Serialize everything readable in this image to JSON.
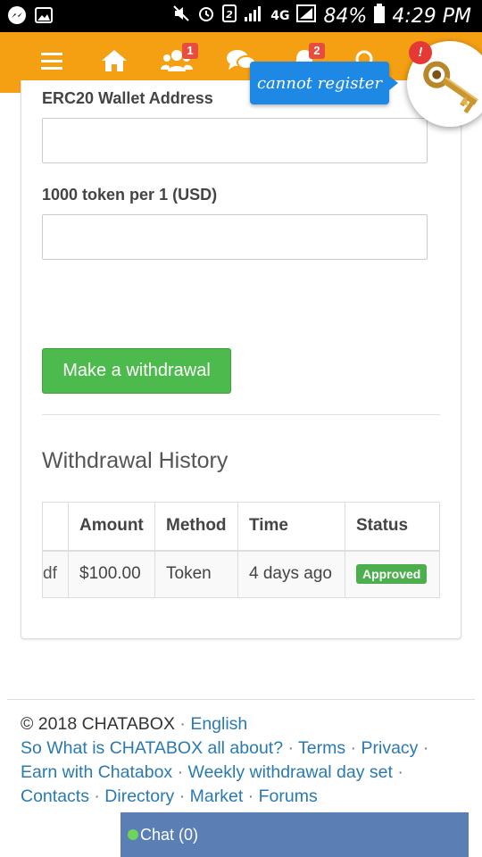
{
  "status_bar": {
    "battery_percent": "84%",
    "time": "4:29 PM",
    "network": "4G"
  },
  "nav": {
    "badges": {
      "users": "1",
      "notifications": "2"
    },
    "alert_dot": "!"
  },
  "tooltip": {
    "text": "cannot register"
  },
  "form": {
    "wallet_label": "ERC20 Wallet Address",
    "wallet_value": "",
    "rate_label": "1000 token per 1 (USD)",
    "rate_value": "",
    "submit_label": "Make a withdrawal"
  },
  "history": {
    "title": "Withdrawal History",
    "columns": [
      "",
      "Amount",
      "Method",
      "Time",
      "Status"
    ],
    "rows": [
      {
        "id": "df",
        "amount": "$100.00",
        "method": "Token",
        "time": "4 days ago",
        "status": "Approved"
      }
    ]
  },
  "footer": {
    "copyright": "© 2018 CHATABOX",
    "language": "English",
    "links": [
      "So What is CHATABOX all about?",
      "Terms",
      "Privacy",
      "Earn with Chatabox",
      "Weekly withdrawal day set",
      "Contacts",
      "Directory",
      "Market",
      "Forums"
    ]
  },
  "chat": {
    "label": "Chat (0)"
  },
  "colors": {
    "nav": "#f5a013",
    "button": "#4cba4c",
    "link": "#2a7ab0",
    "chat": "#5a7fb5",
    "tooltip": "#1e88e5"
  }
}
